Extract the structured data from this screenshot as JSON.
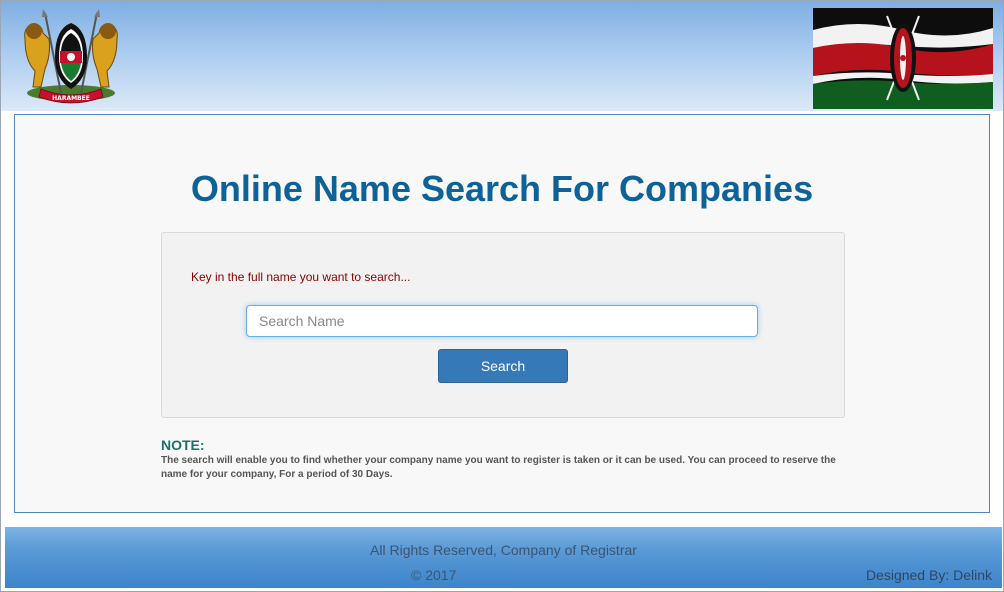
{
  "header": {
    "coat_of_arms_motto": "HARAMBEE"
  },
  "main": {
    "title": "Online Name Search For Companies",
    "instruction": "Key in the full name you want to search...",
    "search": {
      "placeholder": "Search Name",
      "value": ""
    },
    "search_button_label": "Search",
    "note_heading": "NOTE:",
    "note_text": "The search will enable you to find whether your company name you want to register is taken or it can be used. You can proceed to reserve the name for your company, For a period of 30 Days."
  },
  "footer": {
    "rights": "All Rights Reserved, Company of Registrar",
    "copyright": "© 2017",
    "designed_by": "Designed By: Delink"
  },
  "colors": {
    "title": "#0d6297",
    "button": "#3579b8",
    "instruction": "#8b0000",
    "note_heading": "#1f6f66"
  }
}
